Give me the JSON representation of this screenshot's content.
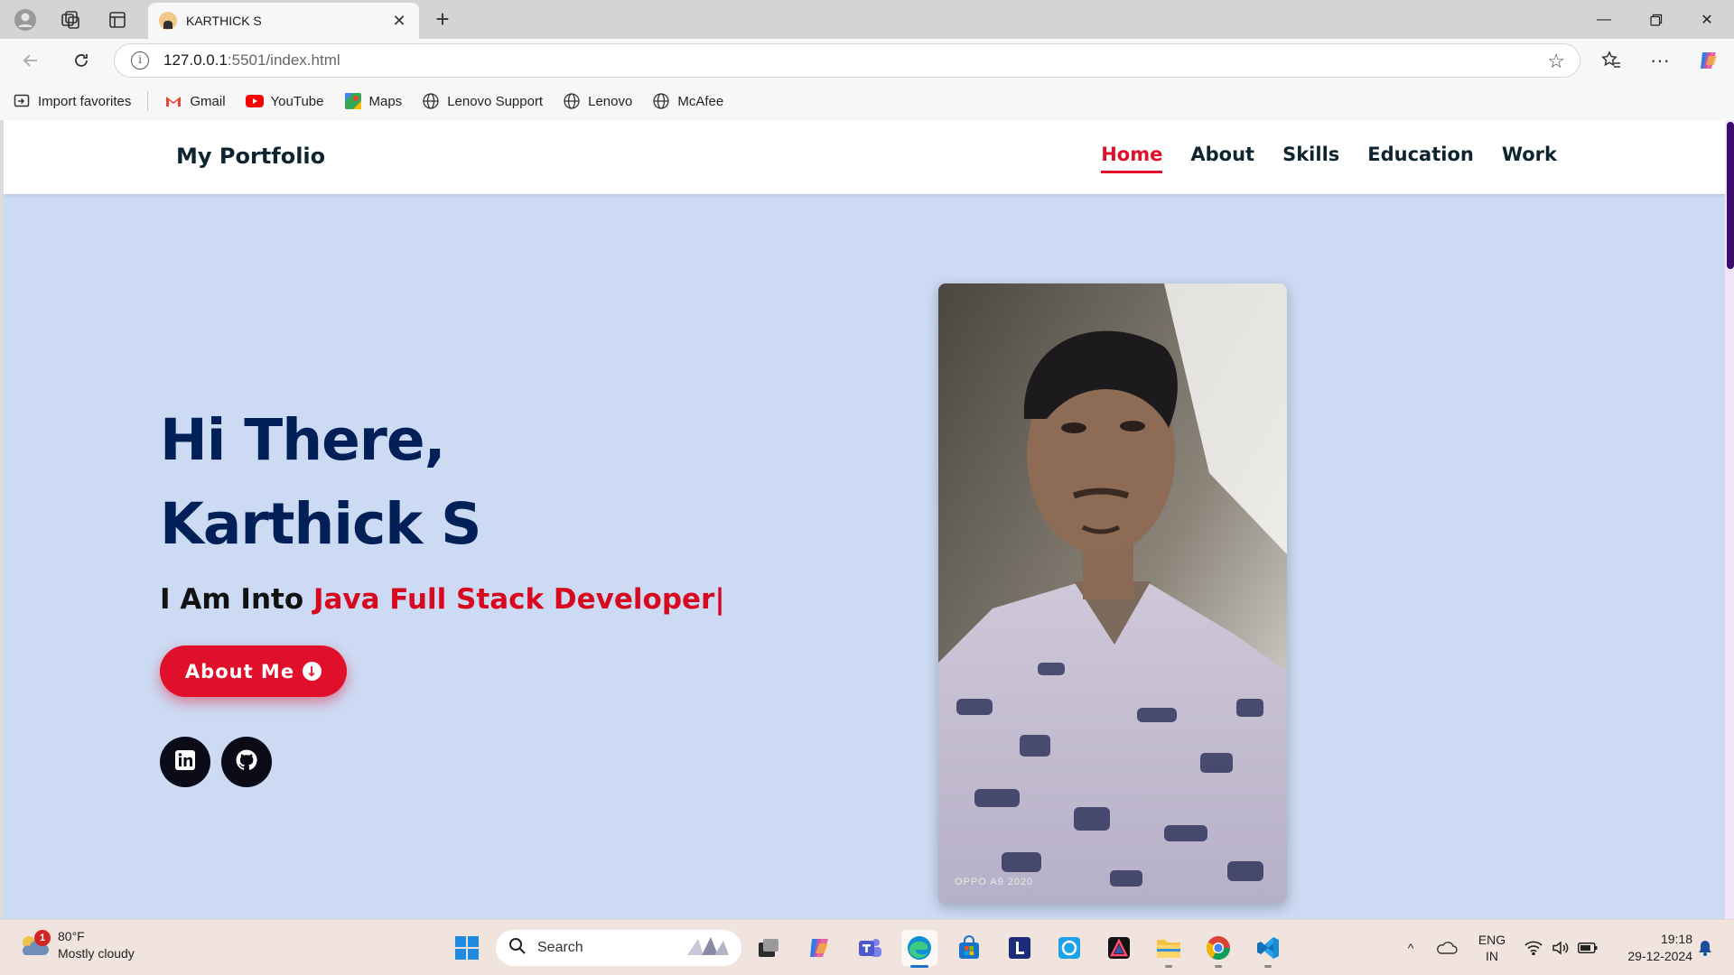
{
  "browser": {
    "tab_title": "KARTHICK S",
    "url_host": "127.0.0.1",
    "url_rest": ":5501/index.html",
    "favorites": [
      {
        "label": "Import favorites",
        "icon": "import-icon"
      },
      {
        "label": "Gmail",
        "icon": "gmail-icon"
      },
      {
        "label": "YouTube",
        "icon": "youtube-icon"
      },
      {
        "label": "Maps",
        "icon": "maps-icon"
      },
      {
        "label": "Lenovo Support",
        "icon": "globe-icon"
      },
      {
        "label": "Lenovo",
        "icon": "globe-icon"
      },
      {
        "label": "McAfee",
        "icon": "globe-icon"
      }
    ]
  },
  "site": {
    "logo": "My Portfolio",
    "nav": [
      {
        "label": "Home",
        "active": true
      },
      {
        "label": "About",
        "active": false
      },
      {
        "label": "Skills",
        "active": false
      },
      {
        "label": "Education",
        "active": false
      },
      {
        "label": "Work",
        "active": false
      }
    ],
    "greeting": "Hi There,",
    "name": "Karthick S",
    "typed_prefix": "I Am Into ",
    "typed_role": "Java Full Stack Developer|",
    "about_button": "About Me",
    "social": [
      "linkedin-icon",
      "github-icon"
    ],
    "photo_stamp": "OPPO A9 2020"
  },
  "colors": {
    "accent": "#e00f2a",
    "hero_bg": "#ccdaf4",
    "heading": "#002057"
  },
  "taskbar": {
    "weather_temp": "80°F",
    "weather_desc": "Mostly cloudy",
    "weather_badge": "1",
    "search_placeholder": "Search",
    "lang_1": "ENG",
    "lang_2": "IN",
    "time": "19:18",
    "date": "29-12-2024"
  }
}
